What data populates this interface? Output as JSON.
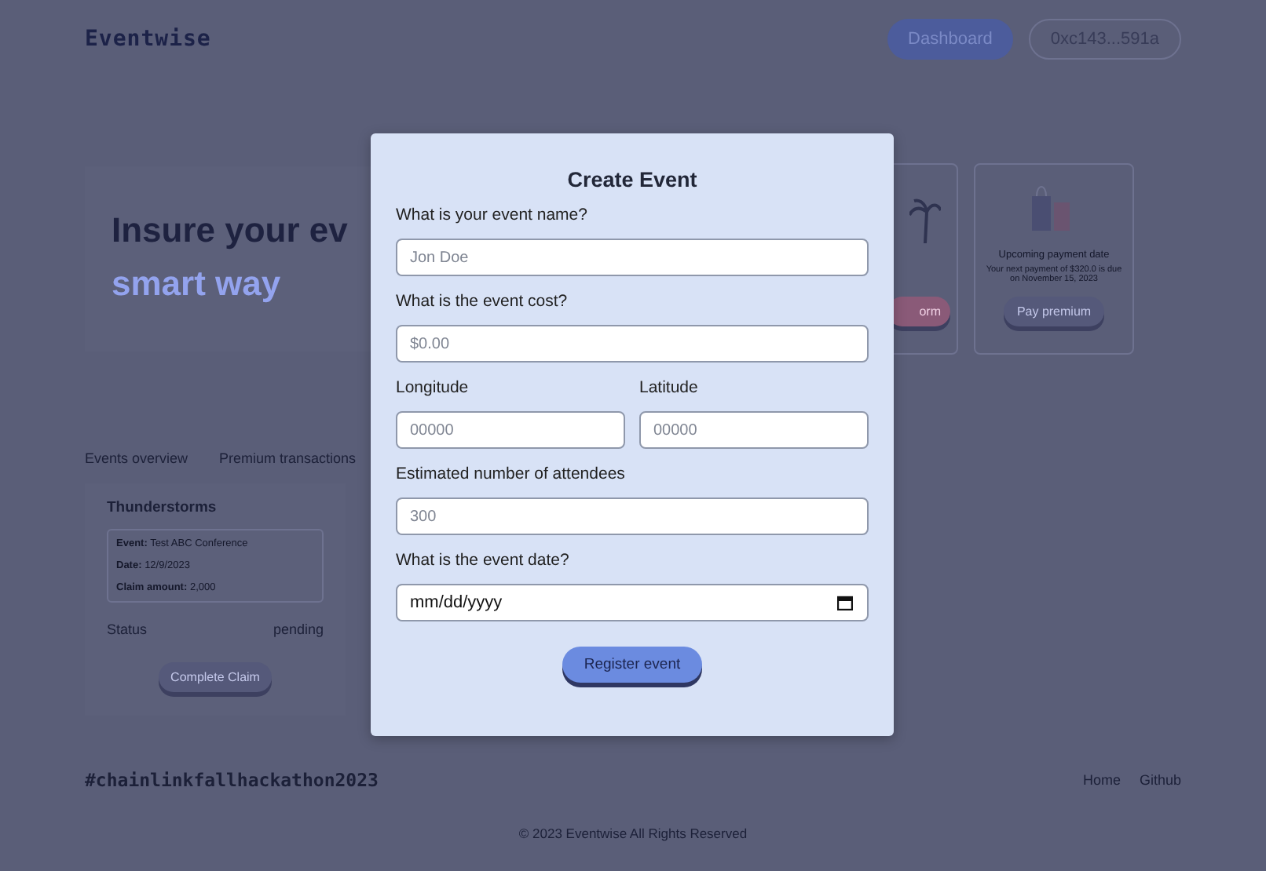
{
  "header": {
    "logo": "Eventwise",
    "buttons": [
      {
        "label": "Dashboard",
        "kind": "primary"
      },
      {
        "label": "0xc143...591a",
        "kind": "outline"
      }
    ]
  },
  "hero": {
    "heading_line_1": "Insure your ev",
    "heading_line_2": "smart way"
  },
  "cards": [
    {
      "kind": "weather",
      "button": "orm"
    },
    {
      "kind": "payment",
      "title": "Upcoming payment date",
      "text": "Your next payment of $320.0 is due on November 15, 2023",
      "button": "Pay premium"
    }
  ],
  "tabs": [
    {
      "label": "Events overview"
    },
    {
      "label": "Premium transactions"
    }
  ],
  "claim": {
    "title": "Thunderstorms",
    "details": [
      "**Event:** Test ABC Conference",
      "**Date:** 12/9/2023",
      "**Claim amount:** 2,000"
    ],
    "status_label": "Status",
    "status": "pending",
    "button": "Complete Claim"
  },
  "footer": {
    "hashtag": "#chainlinkfallhackathon2023",
    "links": [
      "Home",
      "Github"
    ],
    "copyright": "© 2023 Eventwise All Rights Reserved"
  },
  "modal": {
    "title": "Create Event",
    "rows": [
      [
        {
          "label": "What is your event name?",
          "placeholder": "Jon Doe",
          "kind": "text"
        }
      ],
      [
        {
          "label": "What is the event cost?",
          "placeholder": "$0.00",
          "kind": "text"
        }
      ],
      [
        {
          "label": "Longitude",
          "placeholder": "00000",
          "kind": "text"
        },
        {
          "label": "Latitude",
          "placeholder": "00000",
          "kind": "text"
        }
      ],
      [
        {
          "label": "Estimated number of attendees",
          "placeholder": "300",
          "kind": "text"
        }
      ],
      [
        {
          "label": "What is the event date?",
          "placeholder": "mm/dd/yyyy",
          "kind": "date"
        }
      ]
    ],
    "submit": "Register event"
  }
}
